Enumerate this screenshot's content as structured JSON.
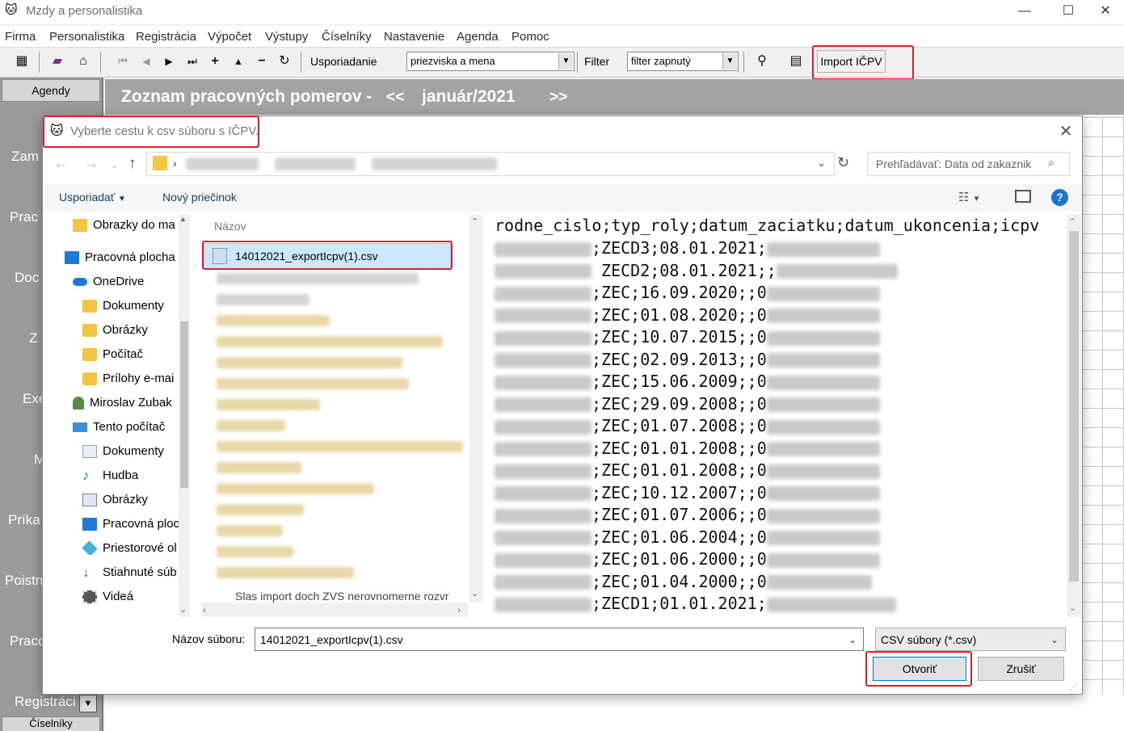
{
  "app": {
    "title": "Mzdy a personalistika",
    "icon": "cat-logo-icon"
  },
  "window_controls": [
    "—",
    "☐",
    "✕"
  ],
  "menu": [
    "Firma",
    "Personalistika",
    "Registrácia",
    "Výpočet",
    "Výstupy",
    "Číselníky",
    "Nastavenie",
    "Agenda",
    "Pomoc"
  ],
  "toolbar": {
    "sort_label": "Usporiadanie",
    "sort_value": "priezviska a mena",
    "filter_label": "Filter",
    "filter_value": "filter zapnutý",
    "import_label": "Import IČPV"
  },
  "left_panel": {
    "tab_top": "Agendy",
    "tab_bottom": "Číselníky",
    "items": [
      "Zam",
      "Prac",
      "Doc",
      "Z",
      "Exe",
      "M",
      "Príka",
      "Poistn",
      "Praco",
      "Registráci"
    ]
  },
  "header": {
    "title": "Zoznam pracovných pomerov -",
    "prev": "<<",
    "month": "január/2021",
    "next": ">>"
  },
  "dialog": {
    "title": "Vyberte cestu k csv súboru s IČPV.",
    "search_placeholder": "Prehľadávať: Data od zakaznik",
    "organize": "Usporiadať",
    "new_folder": "Nový priečinok",
    "nav_tree": [
      {
        "label": "Obrazky do ma",
        "icon": "folder-icon"
      },
      {
        "label": "Pracovná plocha",
        "icon": "desktop-icon"
      },
      {
        "label": "OneDrive",
        "icon": "cloud-icon"
      },
      {
        "label": "Dokumenty",
        "icon": "folder-icon"
      },
      {
        "label": "Obrázky",
        "icon": "folder-icon"
      },
      {
        "label": "Počítač",
        "icon": "folder-icon"
      },
      {
        "label": "Prílohy e-mai",
        "icon": "folder-icon"
      },
      {
        "label": "Miroslav Zubak",
        "icon": "user-icon"
      },
      {
        "label": "Tento počítač",
        "icon": "computer-icon"
      },
      {
        "label": "Dokumenty",
        "icon": "documents-icon"
      },
      {
        "label": "Hudba",
        "icon": "music-icon"
      },
      {
        "label": "Obrázky",
        "icon": "pictures-icon"
      },
      {
        "label": "Pracovná ploc",
        "icon": "desktop-icon"
      },
      {
        "label": "Priestorové ol",
        "icon": "3d-objects-icon"
      },
      {
        "label": "Stiahnuté súb",
        "icon": "download-icon"
      },
      {
        "label": "Videá",
        "icon": "video-icon"
      }
    ],
    "column_name": "Názov",
    "selected_file": "14012021_exportIcpv(1).csv",
    "last_file_partial": "Slas import doch ZVS nerovnomerne rozvr",
    "preview_header": "rodne_cislo;typ_roly;datum_zaciatku;datum_ukoncenia;icpv",
    "preview_rows": [
      ";ZECD3;08.01.2021;",
      " ZECD2;08.01.2021;;",
      ";ZEC;16.09.2020;;0",
      ";ZEC;01.08.2020;;0",
      ";ZEC;10.07.2015;;0",
      ";ZEC;02.09.2013;;0",
      ";ZEC;15.06.2009;;0",
      ";ZEC;29.09.2008;;0",
      ";ZEC;01.07.2008;;0",
      ";ZEC;01.01.2008;;0",
      ";ZEC;01.01.2008;;0",
      ";ZEC;10.12.2007;;0",
      ";ZEC;01.07.2006;;0",
      ";ZEC;01.06.2004;;0",
      ";ZEC;01.06.2000;;0",
      ";ZEC;01.04.2000;;0",
      ";ZECD1;01.01.2021;"
    ],
    "filename_label": "Názov súboru:",
    "filename_value": "14012021_exportIcpv(1).csv",
    "filetype_value": "CSV súbory (*.csv)",
    "open_label": "Otvoriť",
    "cancel_label": "Zrušiť"
  },
  "colors": {
    "highlight": "#e0202a",
    "selection": "#cce8ff",
    "header_bg": "#a3a3a3",
    "help": "#1e6fd1"
  }
}
